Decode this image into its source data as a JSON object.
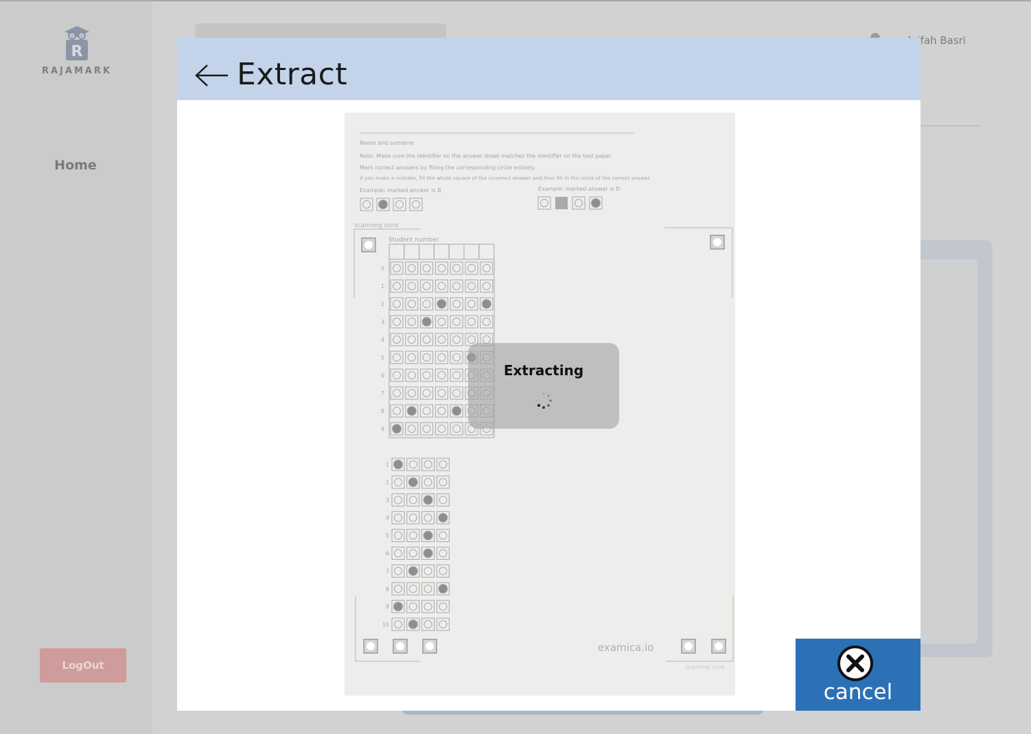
{
  "app": {
    "brand": "RAJAMARK",
    "nav_home": "Home",
    "logout_label": "LogOut",
    "user_name": "Arifah Basri"
  },
  "modal": {
    "title": "Extract",
    "status_text": "Extracting",
    "cancel_label": "cancel"
  },
  "sheet": {
    "name_label": "Name and surname",
    "note_1": "Note: Make sure the identifier on the answer sheet matches the identifier on the test paper.",
    "note_2": "Mark correct answers by filling the corresponding circle entirely.",
    "note_3": "If you make a mistake, fill the whole square of the incorrect answer and then fill in the circle of the correct answer.",
    "example_1": "Example: marked answer is B",
    "example_2": "Example: marked answer is D",
    "scanning_zone": "scanning zone",
    "student_number_label": "Student number",
    "footer_brand": "examica.io",
    "digit_labels": [
      "0",
      "1",
      "2",
      "3",
      "4",
      "5",
      "6",
      "7",
      "8",
      "9"
    ],
    "question_labels": [
      "1",
      "2",
      "3",
      "4",
      "5",
      "6",
      "7",
      "8",
      "9",
      "10"
    ],
    "student_number_filled": [
      9,
      8,
      3,
      2,
      8,
      5,
      2
    ],
    "answers_filled": [
      0,
      1,
      2,
      3,
      2,
      2,
      1,
      3,
      0,
      1
    ]
  },
  "colors": {
    "header_bg": "#c3d4ea",
    "cancel_bg": "#2c71b6",
    "logout_bg": "#cf9b9b"
  }
}
